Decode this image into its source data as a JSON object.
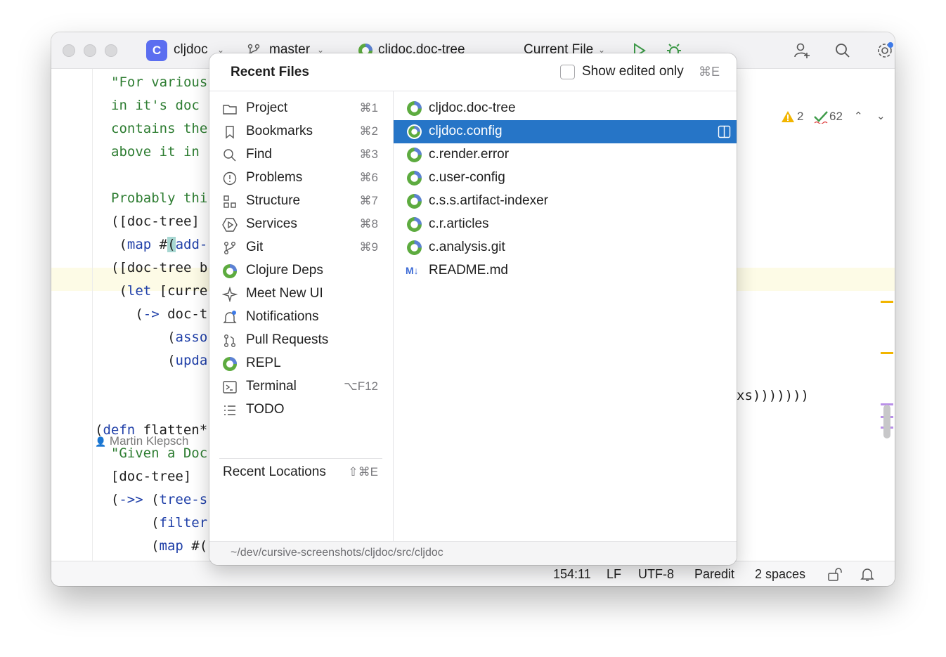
{
  "titlebar": {
    "project_initial": "C",
    "project_name": "cljdoc",
    "branch": "master",
    "open_file": "cljdoc.doc-tree",
    "run_config": "Current File"
  },
  "editor": {
    "warnings": "2",
    "checks": "62",
    "lines": [
      {
        "parts": [
          {
            "t": "\"For various",
            "c": "str"
          }
        ]
      },
      {
        "parts": [
          {
            "t": "in it's doc",
            "c": "str"
          }
        ]
      },
      {
        "parts": [
          {
            "t": "contains the",
            "c": "str"
          }
        ]
      },
      {
        "parts": [
          {
            "t": "above it in",
            "c": "str"
          }
        ]
      },
      {
        "parts": []
      },
      {
        "parts": [
          {
            "t": "Probably thi",
            "c": "str"
          }
        ]
      },
      {
        "parts": [
          {
            "t": "([doc-tree]",
            "c": ""
          }
        ]
      },
      {
        "parts": [
          {
            "t": " (",
            "c": ""
          },
          {
            "t": "map",
            "c": "kw"
          },
          {
            "t": " #",
            "c": ""
          },
          {
            "t": "(",
            "c": "hl"
          },
          {
            "t": "add-",
            "c": "kw"
          }
        ]
      },
      {
        "parts": [
          {
            "t": "([doc-tree b",
            "c": ""
          }
        ]
      },
      {
        "parts": [
          {
            "t": " (",
            "c": ""
          },
          {
            "t": "let",
            "c": "kw"
          },
          {
            "t": " [curre",
            "c": ""
          }
        ]
      },
      {
        "parts": [
          {
            "t": "   (",
            "c": ""
          },
          {
            "t": "->",
            "c": "kw"
          },
          {
            "t": " doc-t",
            "c": ""
          }
        ]
      },
      {
        "parts": [
          {
            "t": "       (",
            "c": ""
          },
          {
            "t": "asso",
            "c": "kw"
          }
        ]
      },
      {
        "parts": [
          {
            "t": "       (",
            "c": ""
          },
          {
            "t": "upda",
            "c": "kw"
          }
        ]
      },
      {
        "parts": []
      },
      {
        "parts": []
      },
      {
        "parts": [
          {
            "t": "(",
            "c": ""
          },
          {
            "t": "defn",
            "c": "kw"
          },
          {
            "t": " flatten*",
            "c": ""
          }
        ]
      },
      {
        "parts": [
          {
            "t": "  \"Given a Doc",
            "c": "str"
          }
        ]
      },
      {
        "parts": [
          {
            "t": "  [doc-tree]",
            "c": ""
          }
        ]
      },
      {
        "parts": [
          {
            "t": "  (",
            "c": ""
          },
          {
            "t": "->>",
            "c": "kw"
          },
          {
            "t": " (",
            "c": ""
          },
          {
            "t": "tree-s",
            "c": "kw"
          }
        ]
      },
      {
        "parts": [
          {
            "t": "       (",
            "c": ""
          },
          {
            "t": "filter",
            "c": "kw"
          }
        ]
      },
      {
        "parts": [
          {
            "t": "       (",
            "c": ""
          },
          {
            "t": "map",
            "c": "kw"
          },
          {
            "t": " #(",
            "c": ""
          }
        ]
      }
    ],
    "line12_tail": "xs)))))))",
    "author": "Martin Klepsch"
  },
  "popup": {
    "title": "Recent Files",
    "show_edited_label": "Show edited only",
    "show_edited_shortcut": "⌘E",
    "nav": [
      {
        "label": "Project",
        "shortcut": "⌘1",
        "icon": "folder-icon"
      },
      {
        "label": "Bookmarks",
        "shortcut": "⌘2",
        "icon": "bookmark-icon"
      },
      {
        "label": "Find",
        "shortcut": "⌘3",
        "icon": "search-icon"
      },
      {
        "label": "Problems",
        "shortcut": "⌘6",
        "icon": "problems-icon"
      },
      {
        "label": "Structure",
        "shortcut": "⌘7",
        "icon": "structure-icon"
      },
      {
        "label": "Services",
        "shortcut": "⌘8",
        "icon": "services-icon"
      },
      {
        "label": "Git",
        "shortcut": "⌘9",
        "icon": "git-icon"
      },
      {
        "label": "Clojure Deps",
        "shortcut": "",
        "icon": "clojure-icon"
      },
      {
        "label": "Meet New UI",
        "shortcut": "",
        "icon": "sparkle-icon"
      },
      {
        "label": "Notifications",
        "shortcut": "",
        "icon": "bell-icon"
      },
      {
        "label": "Pull Requests",
        "shortcut": "",
        "icon": "pull-request-icon"
      },
      {
        "label": "REPL",
        "shortcut": "",
        "icon": "clojure-icon"
      },
      {
        "label": "Terminal",
        "shortcut": "⌥F12",
        "icon": "terminal-icon"
      },
      {
        "label": "TODO",
        "shortcut": "",
        "icon": "list-icon"
      }
    ],
    "recent_locations_label": "Recent Locations",
    "recent_locations_shortcut": "⇧⌘E",
    "files": [
      {
        "label": "cljdoc.doc-tree",
        "type": "clojure"
      },
      {
        "label": "cljdoc.config",
        "type": "clojure",
        "selected": true
      },
      {
        "label": "c.render.error",
        "type": "clojure"
      },
      {
        "label": "c.user-config",
        "type": "clojure"
      },
      {
        "label": "c.s.s.artifact-indexer",
        "type": "clojure"
      },
      {
        "label": "c.r.articles",
        "type": "clojure"
      },
      {
        "label": "c.analysis.git",
        "type": "clojure"
      },
      {
        "label": "README.md",
        "type": "markdown"
      }
    ],
    "md_badge": "M↓",
    "footer_path": "~/dev/cursive-screenshots/cljdoc/src/cljdoc"
  },
  "statusbar": {
    "position": "154:11",
    "line_ending": "LF",
    "encoding": "UTF-8",
    "mode": "Paredit",
    "indent": "2 spaces"
  },
  "colors": {
    "accent": "#2675c7",
    "string": "#2e7d32",
    "keyword": "#1f3fa8",
    "warning": "#f2b500"
  }
}
